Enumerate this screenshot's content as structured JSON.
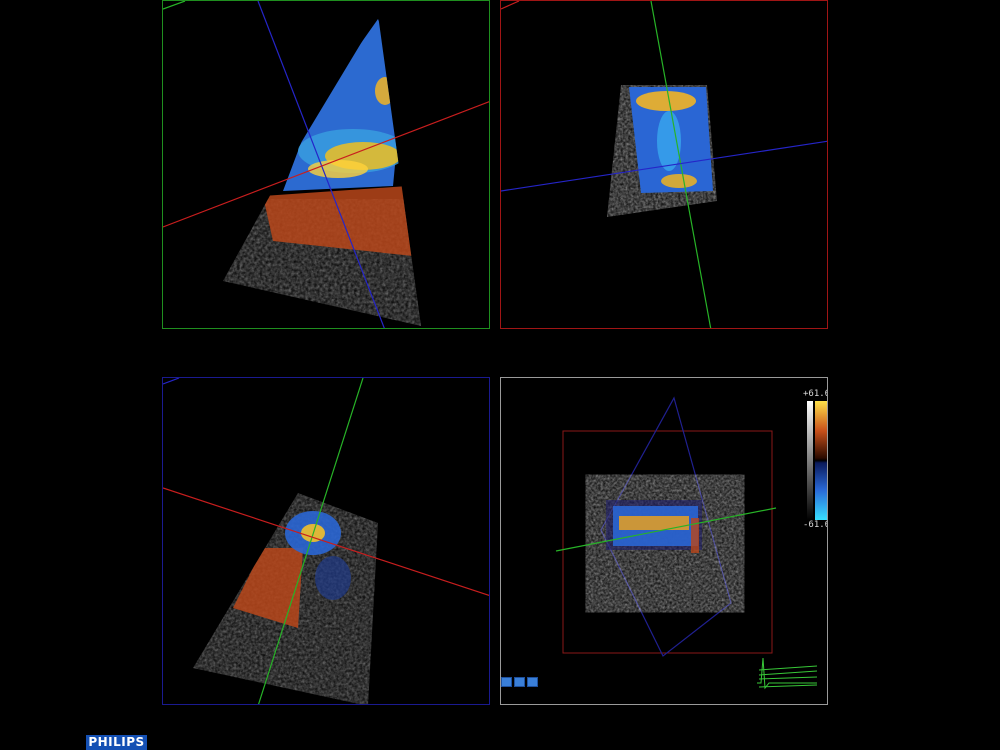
{
  "app": {
    "logo_text": "PHILIPS"
  },
  "panes": [
    {
      "name": "plane-a",
      "border_color": "#1f8f1f"
    },
    {
      "name": "plane-b",
      "border_color": "#a01515"
    },
    {
      "name": "plane-c",
      "border_color": "#1a1a90"
    },
    {
      "name": "volume-3d",
      "border_color": "#9a9a9a"
    }
  ],
  "color_scale": {
    "max_label": "+61.6",
    "min_label": "-61.6",
    "colors": [
      "#ffe14a",
      "#c8501a",
      "#2a0a00",
      "#000000",
      "#0a1a5a",
      "#2a6ad8",
      "#38e0ff"
    ]
  },
  "plane_colors": {
    "green": "#27b327",
    "red": "#c81e1e",
    "blue": "#2525c8"
  },
  "icons": {
    "view_buttons": [
      "cube-view-icon",
      "box-view-icon",
      "box-view-icon"
    ],
    "ecg": "ecg-trace-icon"
  }
}
